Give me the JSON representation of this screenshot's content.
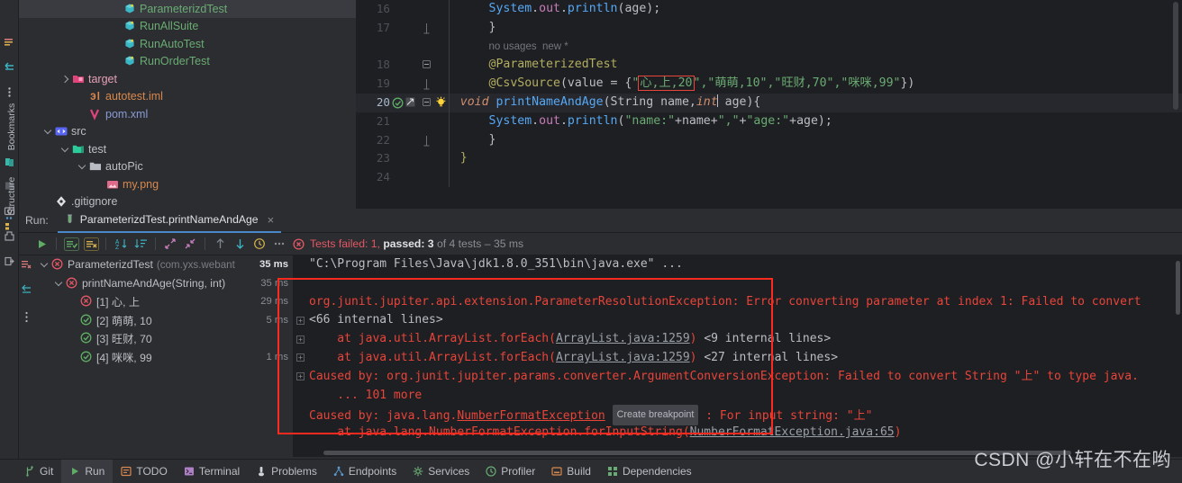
{
  "project_tree": [
    {
      "indent": 5,
      "icon": "java-class-icon",
      "label": "ParameterizdTest",
      "color": "#6aab73",
      "selected": true,
      "chevron": "none"
    },
    {
      "indent": 5,
      "icon": "java-class-icon",
      "label": "RunAllSuite",
      "color": "#6aab73",
      "selected": false,
      "chevron": "none"
    },
    {
      "indent": 5,
      "icon": "java-class-icon",
      "label": "RunAutoTest",
      "color": "#6aab73",
      "selected": false,
      "chevron": "none"
    },
    {
      "indent": 5,
      "icon": "java-class-icon",
      "label": "RunOrderTest",
      "color": "#6aab73",
      "selected": false,
      "chevron": "none"
    },
    {
      "indent": 2,
      "icon": "target-folder-icon",
      "label": "target",
      "color": "#e8a0b8",
      "selected": false,
      "chevron": "right"
    },
    {
      "indent": 3,
      "icon": "iml-file-icon",
      "label": "autotest.iml",
      "color": "#d8884e",
      "selected": false,
      "chevron": "none"
    },
    {
      "indent": 3,
      "icon": "maven-pom-icon",
      "label": "pom.xml",
      "color": "#8a9bd4",
      "selected": false,
      "chevron": "none"
    },
    {
      "indent": 1,
      "icon": "src-folder-icon",
      "label": "src",
      "color": "#bcbec4",
      "selected": false,
      "chevron": "down"
    },
    {
      "indent": 2,
      "icon": "test-folder-icon",
      "label": "test",
      "color": "#bcbec4",
      "selected": false,
      "chevron": "down"
    },
    {
      "indent": 3,
      "icon": "folder-icon",
      "label": "autoPic",
      "color": "#bcbec4",
      "selected": false,
      "chevron": "down"
    },
    {
      "indent": 4,
      "icon": "png-image-icon",
      "label": "my.png",
      "color": "#d8884e",
      "selected": false,
      "chevron": "none"
    },
    {
      "indent": 1,
      "icon": "gitignore-icon",
      "label": ".gitignore",
      "color": "#bcbec4",
      "selected": false,
      "chevron": "none"
    }
  ],
  "editor": {
    "lines": [
      {
        "num": "16",
        "current": false,
        "marker": "none",
        "fold": "none",
        "html": "        <span class='mth'>System</span><span class='brace'>.</span><span class='fld'>out</span><span class='brace'>.</span><span class='mth'>println</span><span class='brace'>(</span><span class='id'>age</span><span class='brace'>);</span>"
      },
      {
        "num": "17",
        "current": false,
        "marker": "none",
        "fold": "end",
        "html": "        <span class='brace'>}</span>"
      },
      {
        "num": "",
        "current": false,
        "marker": "none",
        "fold": "none",
        "html": "        <span class='hint'>no usages&nbsp;&nbsp;new *</span>"
      },
      {
        "num": "18",
        "current": false,
        "marker": "none",
        "fold": "start",
        "html": "        <span class='ann'>@ParameterizedTest</span>"
      },
      {
        "num": "19",
        "current": false,
        "marker": "none",
        "fold": "end",
        "html": "        <span class='ann'>@CsvSource</span><span class='brace'>(</span><span class='id'>value</span> <span class='brace'>=</span> <span class='brace'>{</span><span class='str'>\"</span><span class='csvbox'><span class='str'>心,上,20</span></span><span class='str'>\",\"萌萌,10\",\"旺财,70\",\"咪咪,99\"</span><span class='brace'>})</span>"
      },
      {
        "num": "20",
        "current": true,
        "marker": "run-test",
        "fold": "start",
        "html": "    <span class='ital'>void</span> <span class='mth'>printNameAndAge</span><span class='brace'>(</span><span class='cls'>String</span> <span class='par'>name</span><span class='brace'>,</span><span class='ital'>int</span><span class='caret'></span> <span class='par'>age</span><span class='brace'>){</span>"
      },
      {
        "num": "21",
        "current": false,
        "marker": "none",
        "fold": "none",
        "html": "        <span class='mth'>System</span><span class='brace'>.</span><span class='fld'>out</span><span class='brace'>.</span><span class='mth'>println</span><span class='brace'>(</span><span class='str'>\"name:\"</span><span class='brace'>+</span><span class='id'>name</span><span class='brace'>+</span><span class='str'>\",\"</span><span class='brace'>+</span><span class='str'>\"age:\"</span><span class='brace'>+</span><span class='id'>age</span><span class='brace'>);</span>"
      },
      {
        "num": "22",
        "current": false,
        "marker": "none",
        "fold": "end",
        "html": "        <span class='brace'>}</span>"
      },
      {
        "num": "23",
        "current": false,
        "marker": "none",
        "fold": "none",
        "html": "    <span class='ann'>}</span>"
      },
      {
        "num": "24",
        "current": false,
        "marker": "none",
        "fold": "none",
        "html": ""
      }
    ]
  },
  "run": {
    "label": "Run:",
    "tab_title": "ParameterizdTest.printNameAndAge",
    "tab_close": "×",
    "toolbar_icons": [
      "rerun-icon",
      "show-passed-icon",
      "show-ignored-icon",
      "sort-alphabetically-icon",
      "sort-by-duration-icon",
      "expand-all-icon",
      "collapse-all-icon",
      "previous-failure-icon",
      "next-failure-icon",
      "history-icon",
      "more-options-icon"
    ],
    "status": {
      "prefix": "Tests failed:",
      "failed": "1",
      "passed_label": "passed:",
      "passed": "3",
      "suffix": "of 4 tests – 35 ms"
    },
    "tree": [
      {
        "indent": 0,
        "chevron": "down",
        "status": "failed",
        "label": "ParameterizdTest",
        "pkg": "(com.yxs.webant",
        "ms": "35 ms",
        "bold": true
      },
      {
        "indent": 1,
        "chevron": "down",
        "status": "failed",
        "label": "printNameAndAge(String, int)",
        "pkg": "",
        "ms": "35 ms",
        "bold": false
      },
      {
        "indent": 2,
        "chevron": "none",
        "status": "failed",
        "label": "[1] 心, 上",
        "pkg": "",
        "ms": "29 ms",
        "bold": false
      },
      {
        "indent": 2,
        "chevron": "none",
        "status": "passed",
        "label": "[2] 萌萌, 10",
        "pkg": "",
        "ms": "5 ms",
        "bold": false
      },
      {
        "indent": 2,
        "chevron": "none",
        "status": "passed",
        "label": "[3] 旺财, 70",
        "pkg": "",
        "ms": "",
        "bold": false
      },
      {
        "indent": 2,
        "chevron": "none",
        "status": "passed",
        "label": "[4] 咪咪, 99",
        "pkg": "",
        "ms": "1 ms",
        "bold": false
      }
    ],
    "console": [
      {
        "fold": false,
        "html": "<span class='c-white'>\"C:\\Program Files\\Java\\jdk1.8.0_351\\bin\\java.exe\" ...</span>"
      },
      {
        "fold": false,
        "html": ""
      },
      {
        "fold": false,
        "html": "<span class='c-err'>org.junit.jupiter.api.extension.ParameterResolutionException: Error converting parameter at index 1: Failed to convert</span>"
      },
      {
        "fold": true,
        "html": "<span class='c-white'>&lt;66 internal lines&gt;</span>"
      },
      {
        "fold": true,
        "html": "<span class='c-err'>    at java.util.ArrayList.forEach(</span><span class='c-link'>ArrayList.java:1259</span><span class='c-err'>)</span> <span class='c-white'>&lt;9 internal lines&gt;</span>"
      },
      {
        "fold": true,
        "html": "<span class='c-err'>    at java.util.ArrayList.forEach(</span><span class='c-link'>ArrayList.java:1259</span><span class='c-err'>)</span> <span class='c-white'>&lt;27 internal lines&gt;</span>"
      },
      {
        "fold": true,
        "html": "<span class='c-err'>Caused by: org.junit.jupiter.params.converter.ArgumentConversionException: Failed to convert String \"上\" to type java.</span>"
      },
      {
        "fold": false,
        "html": "<span class='c-err'>    ... 101 more</span>"
      },
      {
        "fold": false,
        "html": "<span class='c-err'>Caused by: java.lang.</span><span class='c-link2'>NumberFormatException</span> <span class='bpbadge'>Create breakpoint</span><span class='c-err'> : For input string: \"上\"</span>"
      },
      {
        "fold": false,
        "html": "<span class='c-err'>    at java.lang.NumberFormatException.forInputString(</span><span class='c-link'>NumberFormatException.java:65</span><span class='c-err'>)</span>"
      }
    ]
  },
  "rail_items": [
    {
      "name": "bookmarks",
      "label": "Bookmarks"
    },
    {
      "name": "structure",
      "label": "Structure"
    }
  ],
  "statusbar": {
    "items": [
      {
        "icon": "git-branch-icon",
        "label": "Git",
        "active": false,
        "color": "#6aab73"
      },
      {
        "icon": "run-play-icon",
        "label": "Run",
        "active": true,
        "color": "#5fad65"
      },
      {
        "icon": "todo-icon",
        "label": "TODO",
        "active": false,
        "color": "#d8884e"
      },
      {
        "icon": "terminal-icon",
        "label": "Terminal",
        "active": false,
        "color": "#b07fc7"
      },
      {
        "icon": "problems-icon",
        "label": "Problems",
        "active": false,
        "color": "#d0d3d9"
      },
      {
        "icon": "endpoints-icon",
        "label": "Endpoints",
        "active": false,
        "color": "#5a9bd4"
      },
      {
        "icon": "services-icon",
        "label": "Services",
        "active": false,
        "color": "#6aab73"
      },
      {
        "icon": "profiler-icon",
        "label": "Profiler",
        "active": false,
        "color": "#6aab73"
      },
      {
        "icon": "build-icon",
        "label": "Build",
        "active": false,
        "color": "#d8884e"
      },
      {
        "icon": "dependencies-icon",
        "label": "Dependencies",
        "active": false,
        "color": "#6aab73"
      }
    ]
  },
  "watermark": "CSDN @小轩在不在哟",
  "colors": {
    "bg": "#2b2d30",
    "editor_bg": "#1e1f22",
    "accent_red": "#fd2b1f",
    "error_text": "#e8443a",
    "pass_green": "#5fad65",
    "fail_red": "#e55765"
  }
}
